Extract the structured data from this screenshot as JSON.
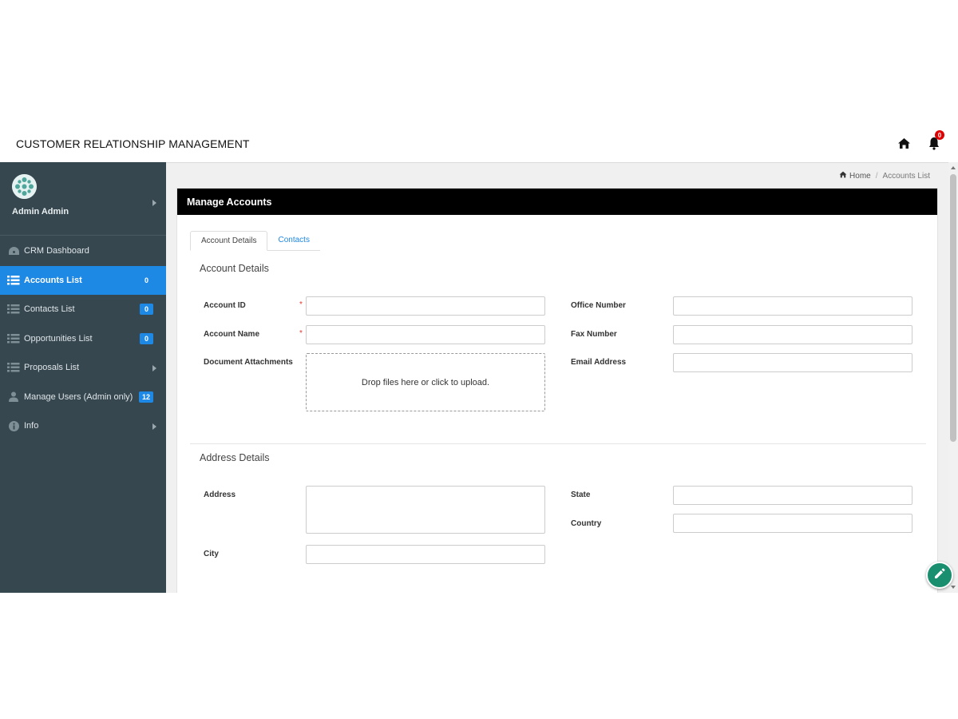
{
  "header": {
    "title": "CUSTOMER RELATIONSHIP MANAGEMENT",
    "home_icon": "home-icon",
    "notification_icon": "bell-icon",
    "notification_count": "0"
  },
  "sidebar": {
    "user_name": "Admin Admin",
    "items": [
      {
        "label": "CRM Dashboard",
        "icon": "dashboard-icon",
        "badge": ""
      },
      {
        "label": "Accounts List",
        "icon": "list-icon",
        "badge": "0"
      },
      {
        "label": "Contacts List",
        "icon": "list-icon",
        "badge": "0"
      },
      {
        "label": "Opportunities List",
        "icon": "list-icon",
        "badge": "0"
      },
      {
        "label": "Proposals List",
        "icon": "list-icon",
        "badge": ""
      },
      {
        "label": "Manage Users (Admin only)",
        "icon": "user-icon",
        "badge": "12"
      },
      {
        "label": "Info",
        "icon": "info-icon",
        "badge": ""
      }
    ]
  },
  "breadcrumb": {
    "home": "Home",
    "current": "Accounts List"
  },
  "panel": {
    "title": "Manage Accounts",
    "tabs": [
      {
        "label": "Account Details"
      },
      {
        "label": "Contacts"
      }
    ],
    "account_section": {
      "title": "Account Details",
      "account_id_label": "Account ID",
      "account_name_label": "Account Name",
      "attachments_label": "Document Attachments",
      "dropzone_text": "Drop files here or click to upload.",
      "office_number_label": "Office Number",
      "fax_number_label": "Fax Number",
      "email_label": "Email Address",
      "required_mark": "*"
    },
    "address_section": {
      "title": "Address Details",
      "address_label": "Address",
      "city_label": "City",
      "state_label": "State",
      "country_label": "Country"
    }
  },
  "colors": {
    "sidebar_bg": "#37474f",
    "active_item": "#1e88e5",
    "panel_header": "#000000",
    "fab": "#1a8f70"
  }
}
